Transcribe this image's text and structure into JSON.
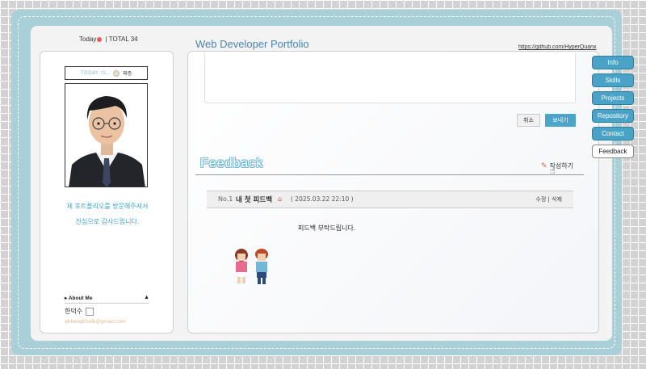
{
  "header": {
    "visit_label": "Today",
    "total_text": "TOTAL 34",
    "site_title": "Web Developer Portfolio",
    "github_link": "https://github.com/HyperQuanx"
  },
  "sidebar": {
    "today_label": "TODAY IS..",
    "mood": "짜증",
    "greeting_line1": "제 포트폴리오를 방문해주셔서",
    "greeting_line2": "진심으로 감사드립니다.",
    "about_label": "About Me",
    "about_toggle": "▲",
    "name": "한덕수",
    "email": "qhlwoqkfudk@gmail.com"
  },
  "comment_form": {
    "cancel_label": "취소",
    "send_label": "보내기"
  },
  "feedback": {
    "title": "Feedback",
    "write_label": "작성하기",
    "post": {
      "number": "No.1",
      "title": "내 첫 피드백",
      "date": "( 2025.03.22 22:10 )",
      "edit_label": "수정",
      "separator": "|",
      "delete_label": "삭제",
      "body": "피드백 부탁드립니다."
    }
  },
  "nav": {
    "tabs": [
      "Info",
      "Skills",
      "Projects",
      "Repository",
      "Contact",
      "Feedback"
    ],
    "active": "Feedback"
  },
  "colors": {
    "accent": "#4aa3c6",
    "frame": "#a9cfd8",
    "title": "#4a86ad",
    "greeting": "#3aa5c8"
  }
}
